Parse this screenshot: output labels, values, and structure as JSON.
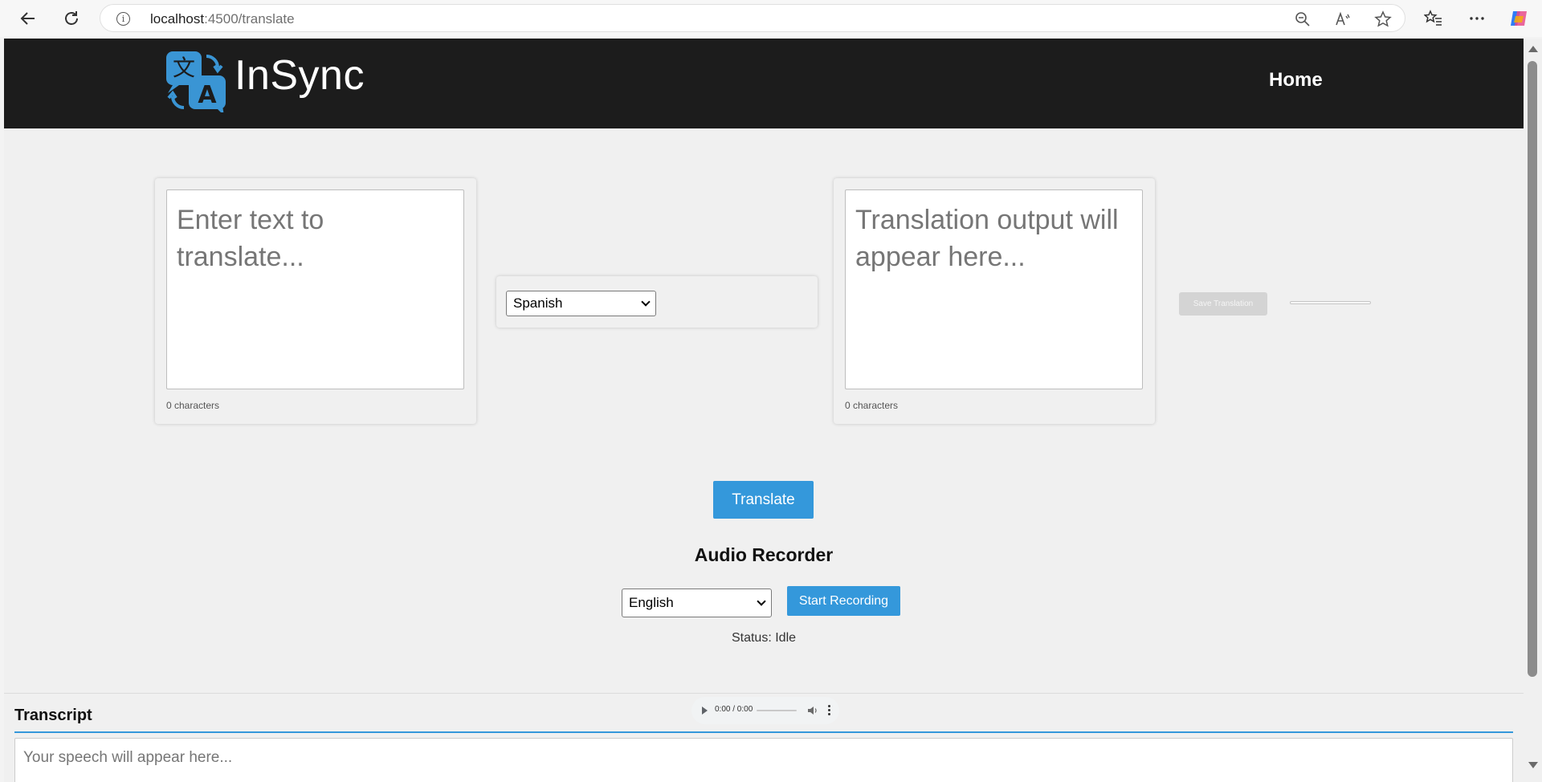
{
  "browser": {
    "url_host": "localhost",
    "url_path": ":4500/translate",
    "icons": [
      "back-icon",
      "refresh-icon",
      "info-icon",
      "zoom-out-icon",
      "read-aloud-icon",
      "favorite-star-icon",
      "favorites-icon",
      "more-icon",
      "copilot-icon"
    ]
  },
  "header": {
    "brand": "InSync",
    "nav_home": "Home",
    "logo_icon": "translate-icon",
    "logo_glyph_top": "文",
    "logo_glyph_bottom": "A"
  },
  "source": {
    "placeholder": "Enter text to translate...",
    "char_count": "0 characters"
  },
  "language_select": {
    "selected": "Spanish"
  },
  "output": {
    "placeholder": "Translation output will appear here...",
    "char_count": "0 characters",
    "save_label": "Save Translation"
  },
  "translate_button": "Translate",
  "audio": {
    "title": "Audio Recorder",
    "language_selected": "English",
    "start_label": "Start Recording",
    "status": "Status: Idle",
    "player_time": "0:00 / 0:00"
  },
  "transcript": {
    "title": "Transcript",
    "placeholder": "Your speech will appear here..."
  },
  "colors": {
    "header_bg": "#1c1c1c",
    "accent": "#3498db",
    "page_bg": "#f0f0f0"
  }
}
